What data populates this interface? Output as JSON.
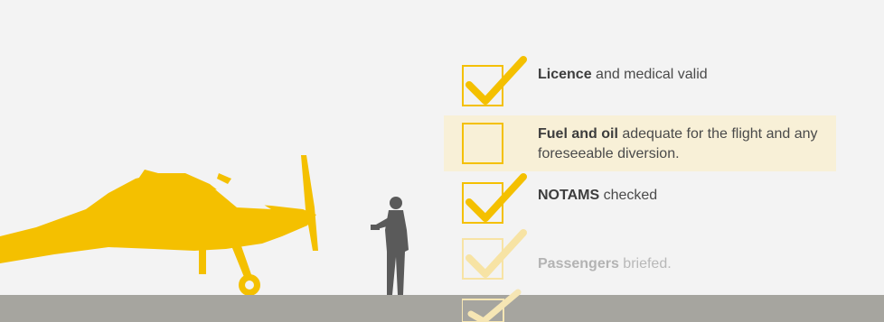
{
  "checklist": {
    "items": [
      {
        "bold": "Licence",
        "text": " and medical valid",
        "checked": true,
        "faded": false,
        "highlight": false
      },
      {
        "bold": "Fuel and oil",
        "text": " adequate for the flight and any foreseeable diversion.",
        "checked": false,
        "faded": false,
        "highlight": true
      },
      {
        "bold": "NOTAMS",
        "text": " checked",
        "checked": true,
        "faded": false,
        "highlight": false
      },
      {
        "bold": "Passengers",
        "text": " briefed.",
        "checked": true,
        "faded": true,
        "highlight": false
      }
    ]
  },
  "colors": {
    "accent": "#f4c000",
    "accent_faded": "#f7e3a4",
    "highlight": "#f8f0d7",
    "ground": "#a6a59f",
    "person": "#5a5a5a",
    "text": "#4a4a4a"
  },
  "icons": [
    "checkmark-icon",
    "airplane-silhouette",
    "person-silhouette"
  ]
}
